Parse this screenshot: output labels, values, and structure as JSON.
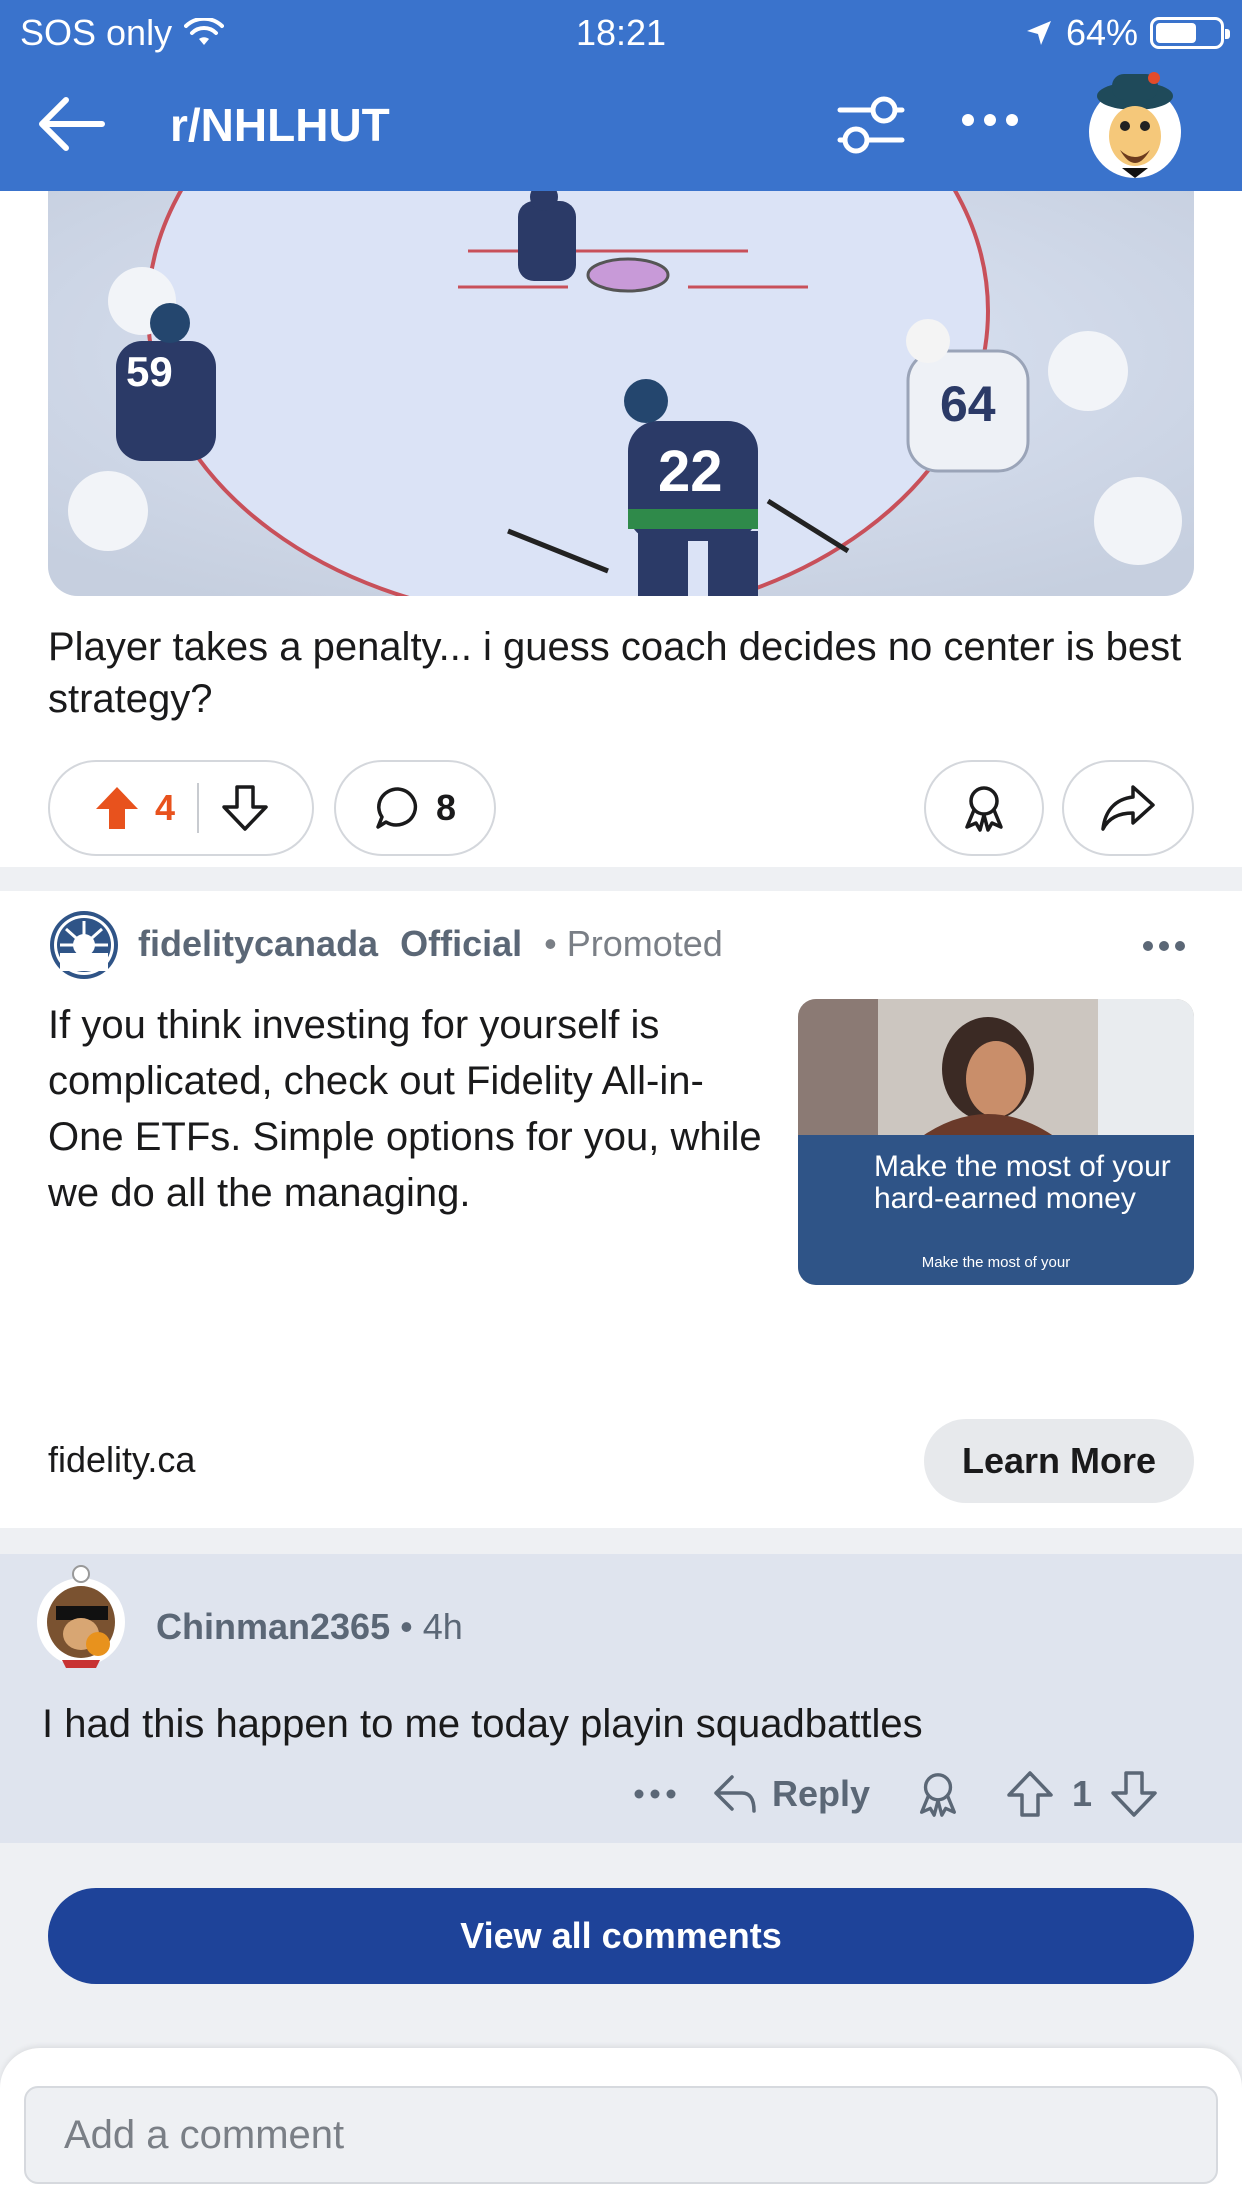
{
  "status_bar": {
    "carrier": "SOS only",
    "time": "18:21",
    "battery": "64%",
    "battery_level": 0.64
  },
  "header": {
    "subreddit": "r/NHLHUT",
    "back_icon": "arrow-left-icon",
    "filter_icon": "sliders-icon",
    "more_icon": "more-horizontal-icon"
  },
  "post": {
    "title": "Player takes a penalty... i guess coach decides no center is best strategy?",
    "upvotes": "4",
    "comments": "8",
    "upvote_color": "#e8521d",
    "image_jerseys": [
      "22",
      "64",
      "59"
    ]
  },
  "ad": {
    "username": "fidelitycanada",
    "official": "Official",
    "promoted": "• Promoted",
    "body": "If you think investing for yourself is complicated, check out Fidelity All-in-One ETFs. Simple options for you, while we do all the managing.",
    "video_caption": "Make the most of your hard-earned money",
    "video_subcaption": "Make the most of your",
    "domain": "fidelity.ca",
    "cta": "Learn More"
  },
  "comment": {
    "author": "Chinman2365",
    "time": "• 4h",
    "body": "I had this happen to me today playin squadbattles",
    "reply": "Reply",
    "score": "1"
  },
  "view_all": "View all comments",
  "composer": {
    "placeholder": "Add a comment"
  },
  "colors": {
    "header_bg": "#3a73cc",
    "primary_button": "#1e4399",
    "comment_bg": "#dfe4ee"
  }
}
